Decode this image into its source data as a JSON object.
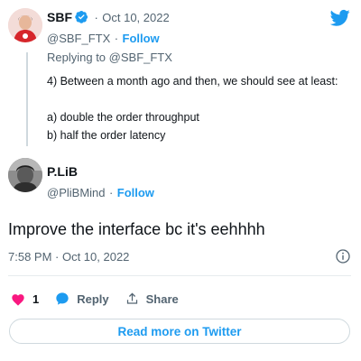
{
  "reply_tweet": {
    "author_name": "SBF",
    "date": "Oct 10, 2022",
    "handle": "@SBF_FTX",
    "follow_label": "Follow",
    "replying_to": "Replying to @SBF_FTX",
    "lines": [
      "4) Between a month ago and then, we should see at least:",
      "a) double the order throughput",
      "b) half the order latency"
    ]
  },
  "main_tweet": {
    "author_name": "P.LiB",
    "handle": "@PliBMind",
    "follow_label": "Follow",
    "text": "Improve the interface bc it's eehhhh",
    "timestamp": "7:58 PM · Oct 10, 2022"
  },
  "actions": {
    "like_count": "1",
    "reply_label": "Reply",
    "share_label": "Share"
  },
  "read_more_label": "Read more on Twitter",
  "colors": {
    "accent": "#1d9bf0",
    "like": "#f91880",
    "muted": "#536471",
    "text": "#0f1419"
  },
  "icons": [
    "twitter-logo",
    "verified-badge-icon",
    "info-icon",
    "heart-icon",
    "reply-bubble-icon",
    "share-icon"
  ]
}
